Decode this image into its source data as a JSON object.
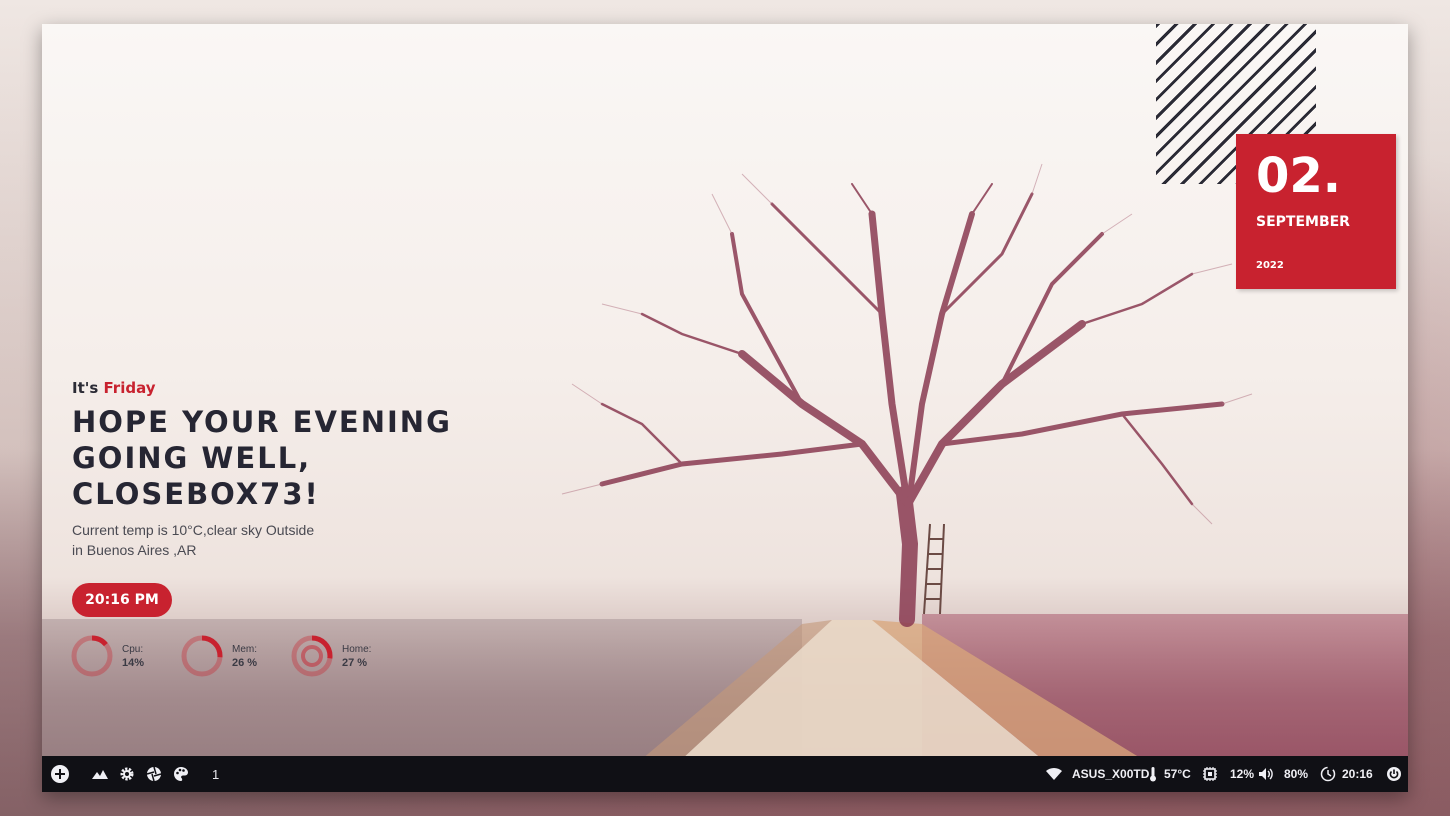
{
  "desktop": {
    "date": {
      "day": "02.",
      "month": "SEPTEMBER",
      "year": "2022"
    },
    "greeting": {
      "prefix": "It's",
      "weekday": "Friday"
    },
    "headline": "HOPE YOUR EVENING GOING WELL, CLOSEBOX73!",
    "weather": {
      "line1": "Current temp is 10°C,clear sky Outside",
      "line2": "in Buenos Aires ,AR"
    },
    "clock_pill": "20:16 PM",
    "gauges": [
      {
        "label": "Cpu:",
        "value": "14%",
        "percent": 14
      },
      {
        "label": "Mem:",
        "value": "26 %",
        "percent": 26
      },
      {
        "label": "Home:",
        "value": "27 %",
        "percent": 27
      }
    ],
    "colors": {
      "accent": "#c8222f",
      "text": "#262633",
      "bar": "#101015"
    }
  },
  "taskbar": {
    "launcher_icon": "add-circle-icon",
    "left_icons": [
      "mountain-icon",
      "gear-icon",
      "aperture-icon",
      "palette-icon"
    ],
    "workspace": "1",
    "wifi": {
      "icon": "wifi-icon",
      "label": "ASUS_X00TD"
    },
    "temperature": {
      "icon": "thermometer-icon",
      "label": "57°C"
    },
    "cpu": {
      "icon": "cpu-chip-icon",
      "label": "12%"
    },
    "volume": {
      "icon": "speaker-icon",
      "label": "80%"
    },
    "clock": {
      "icon": "clock-icon",
      "label": "20:16"
    },
    "power_icon": "power-icon"
  }
}
